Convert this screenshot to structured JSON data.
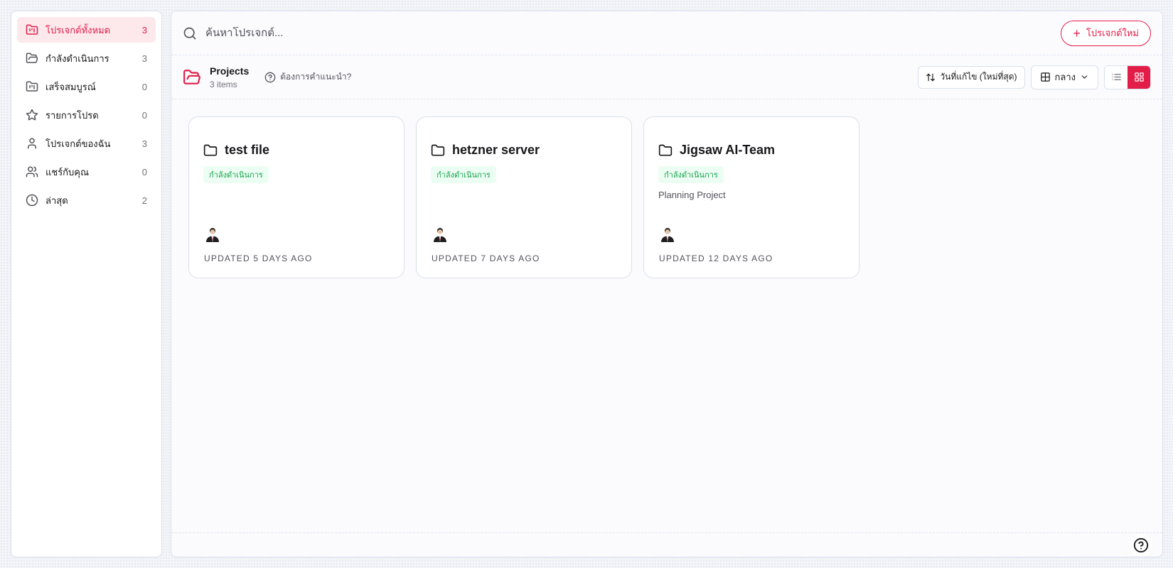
{
  "sidebar": {
    "items": [
      {
        "label": "โปรเจกต์ทั้งหมด",
        "count": "3",
        "icon": "folder-kanban-icon",
        "active": true
      },
      {
        "label": "กำลังดำเนินการ",
        "count": "3",
        "icon": "folder-open-icon"
      },
      {
        "label": "เสร็จสมบูรณ์",
        "count": "0",
        "icon": "folder-kanban-icon"
      },
      {
        "label": "รายการโปรด",
        "count": "0",
        "icon": "star-icon"
      },
      {
        "label": "โปรเจกต์ของฉัน",
        "count": "3",
        "icon": "user-icon"
      },
      {
        "label": "แชร์กับคุณ",
        "count": "0",
        "icon": "users-icon"
      },
      {
        "label": "ล่าสุด",
        "count": "2",
        "icon": "clock-icon"
      }
    ]
  },
  "search": {
    "placeholder": "ค้นหาโปรเจกต์..."
  },
  "header": {
    "new_project_label": "โปรเจกต์ใหม่"
  },
  "toolbar": {
    "title": "Projects",
    "count": "3 items",
    "help_label": "ต้องการคำแนะนำ?",
    "sort_label": "วันที่แก้ไข (ใหม่ที่สุด)",
    "size_label": "กลาง"
  },
  "projects": [
    {
      "name": "test file",
      "status": "กำลังดำเนินการ",
      "description": "",
      "updated": "UPDATED 5 DAYS AGO"
    },
    {
      "name": "hetzner server",
      "status": "กำลังดำเนินการ",
      "description": "",
      "updated": "UPDATED 7 DAYS AGO"
    },
    {
      "name": "Jigsaw AI-Team",
      "status": "กำลังดำเนินการ",
      "description": "Planning Project",
      "updated": "UPDATED 12 DAYS AGO"
    }
  ],
  "colors": {
    "accent": "#e11d48",
    "status_green": "#16a34a"
  }
}
